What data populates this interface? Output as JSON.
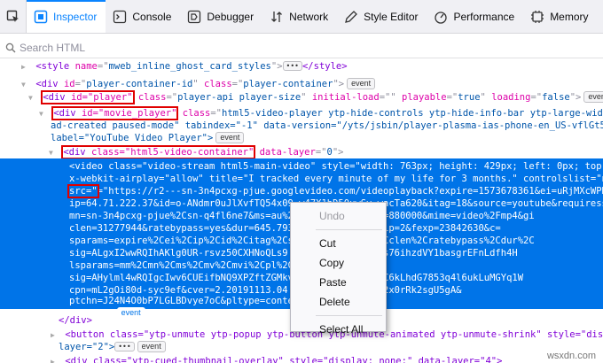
{
  "toolbar": {
    "tabs": [
      {
        "label": "Inspector",
        "active": true
      },
      {
        "label": "Console"
      },
      {
        "label": "Debugger"
      },
      {
        "label": "Network"
      },
      {
        "label": "Style Editor"
      },
      {
        "label": "Performance"
      },
      {
        "label": "Memory"
      }
    ]
  },
  "search": {
    "placeholder": "Search HTML"
  },
  "tree": {
    "l1": {
      "tag": "style",
      "attr": "name",
      "val": "mweb_inline_ghost_card_styles",
      "close": "</style>"
    },
    "l2": {
      "tag": "div",
      "attr": "id",
      "val": "player-container-id",
      "attr2": "class",
      "val2": "player-container",
      "badge": "event"
    },
    "l3": {
      "tag": "div",
      "hl": "id=\"player\"",
      "rest_a1": "class",
      "rest_v1": "player-api player-size",
      "rest_a2": "initial-load",
      "rest_v2": "",
      "rest_a3": "playable",
      "rest_v3": "true",
      "rest_a4": "loading",
      "rest_v4": "false",
      "badge1": "event",
      "badge2": "flex"
    },
    "l4": {
      "tag": "div",
      "hl": "id=\"movie_player\"",
      "attr": "class",
      "val": "html5-video-player ytp-hide-controls ytp-hide-info-bar ytp-large-width-mode"
    },
    "l5": {
      "text": "ad-created paused-mode\" tabindex=\"-1\" data-version=\"/yts/jsbin/player-plasma-ias-phone-en_US-vflGt5mqC/base"
    },
    "l6": {
      "text": "label=\"YouTube Video Player\">",
      "badge": "event"
    },
    "l7": {
      "tag": "div",
      "hl": "class=\"html5-video-container\"",
      "attr": "data-layer",
      "val": "0"
    },
    "sel": [
      "<video class=\"video-stream html5-main-video\" style=\"width: 763px; height: 429px; left: 0px; top: 0px",
      "x-webkit-airplay=\"allow\" title=\"I tracked every minute of my life for 3 months.\" controlslist=\"nodow",
      "=\"https://r2---sn-3n4pcxg-pjue.googlevideo.com/videoplayback?expire=1573678361&ei=uRjMXcWPK5bwNoK",
      "ip=64.71.222.37&id=o-ANdmr0uJlXvfTQ54x09-w47X1hD50uwSy wacTa620&itag=18&source=youtube&requiressl=",
      "mn=sn-3n4pcxg-pjue%2Csn-q4fl6ne7&ms=au%2C                        %2Cinitcwndbps=880000&mime=video%2Fmp4&gi",
      "clen=31277944&ratebypass=yes&dur=645.793&                         =1573656640&fvip=2&fexp=23842630&c=",
      "sparams=expire%2Cei%2Cip%2Cid%2Citag%2Cso                        2Cmime%2Cgir%2Cclen%2Cratebypass%2Cdur%2C",
      "sig=ALgxI2wwRQIhAKlg0UR-rsvz50CXHNoQLs9                             CAiBOW8PIzt6OzSts76ihzdVY1basgrEFnLdfh4H",
      "lsparams=mm%2Cmn%2Cms%2Cmv%2Cmvi%2Cpl%2Ci",
      "sig=AHylml4wRQIgcIwv6CUEifbNQ9XPZftZGMkv                        CIQDP-E19kDjF30C6kLhdG7853q4l6ukLuMGYq1W",
      "cpn=mL2gOi80d-syc9ef&cver=2.20191113.04.0                        &oid=d1Hwvi8Ye2x0rRk2sgU5gA&",
      "ptchn=J24N4O0bP7LGLBDvye7oC&pltype=conte",
      "</video>"
    ],
    "sel_src": "src=\"",
    "sel_badge": "event",
    "after": [
      "</div>",
      "<button class=\"ytp-unmute ytp-popup ytp-button ytp-unmute-animated ytp-unmute-shrink\" style=\"display: ",
      "layer=\"2\">",
      "<div class=\"ytp-cued-thumbnail-overlay\" style=\"display: none;\" data-layer=\"4\">"
    ],
    "after_badge": "event",
    "after_dots": "•••"
  },
  "menu": {
    "items": [
      {
        "label": "Undo",
        "disabled": true
      },
      {
        "label": "Cut"
      },
      {
        "label": "Copy"
      },
      {
        "label": "Paste"
      },
      {
        "label": "Delete"
      },
      {
        "label": "Select All"
      }
    ]
  },
  "watermark": "wsxdn.com",
  "colors": {
    "accent": "#0a84ff",
    "selection": "#0074e8",
    "highlight": "#e00000"
  }
}
